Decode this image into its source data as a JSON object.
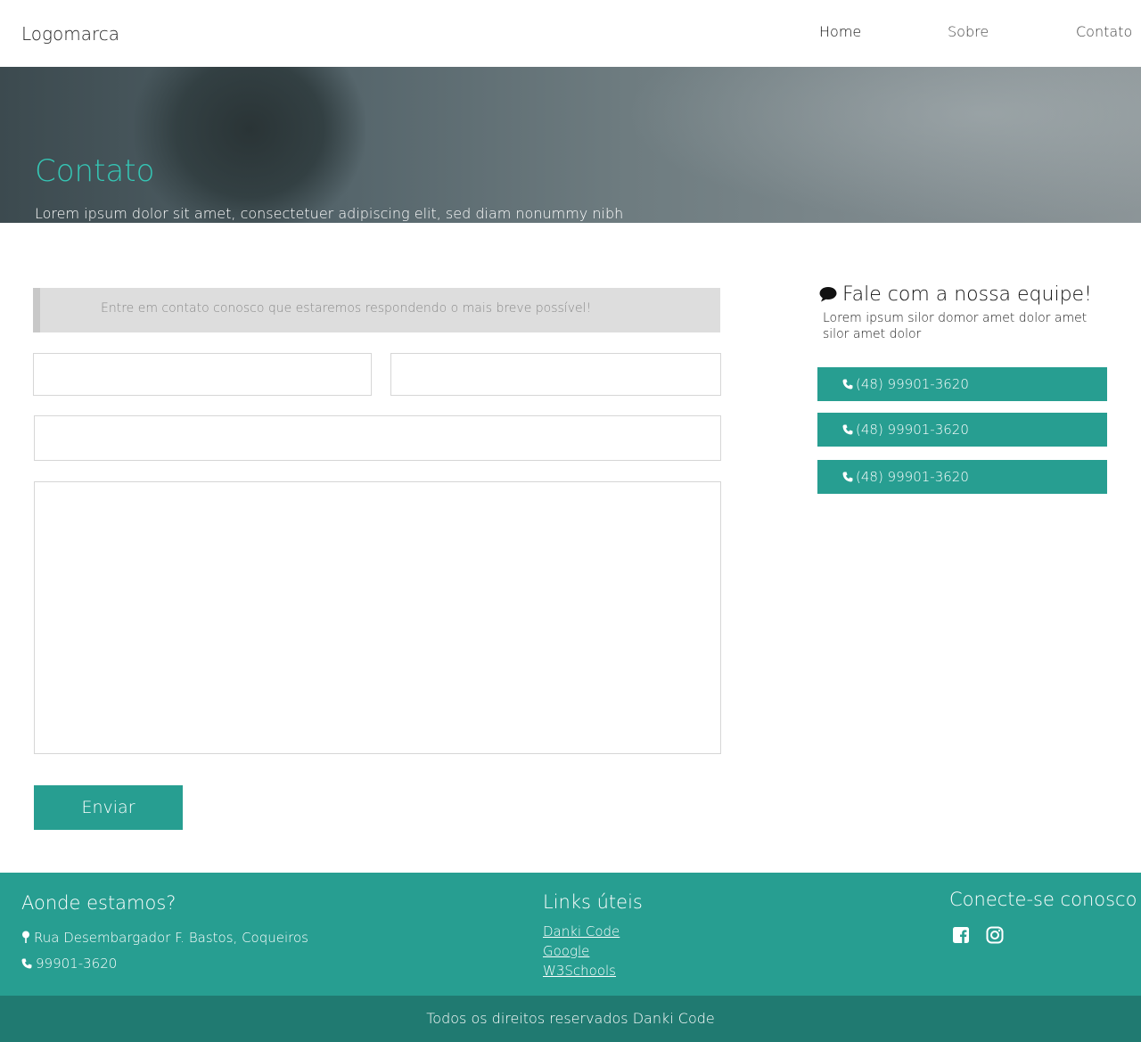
{
  "header": {
    "logo": "Logomarca",
    "nav": [
      "Home",
      "Sobre",
      "Contato"
    ]
  },
  "banner": {
    "title": "Contato",
    "text": "Lorem ipsum dolor sit amet, consectetuer adipiscing elit, sed diam nonummy nibh euismod tincidunt ut laoreet dolore magna aliquam erat volutpat. Ut wisi enim ad minim veniam, quis.."
  },
  "form": {
    "notice": "Entre em contato conosco que estaremos respondendo o mais breve possível!",
    "name_value": "",
    "email_value": "",
    "phone_value": "",
    "message_value": "",
    "submit_label": "Enviar"
  },
  "sidebar": {
    "title": "Fale com a nossa equipe!",
    "description": "Lorem ipsum silor domor amet dolor amet silor amet dolor",
    "phones": [
      "(48) 99901-3620",
      "(48) 99901-3620",
      "(48) 99901-3620"
    ]
  },
  "footer": {
    "location_title": "Aonde estamos?",
    "address": "Rua Desembargador F. Bastos, Coqueiros",
    "phone": "99901-3620",
    "links_title": "Links úteis",
    "links": [
      "Danki Code",
      "Google",
      "W3Schools"
    ],
    "social_title": "Conecte-se conosco",
    "social_icons": [
      "facebook-icon",
      "instagram-icon"
    ],
    "copyright": "Todos os direitos reservados Danki Code"
  },
  "colors": {
    "accent": "#279e91",
    "footer_bottom": "#207a71",
    "banner_title": "#35c5b4"
  }
}
